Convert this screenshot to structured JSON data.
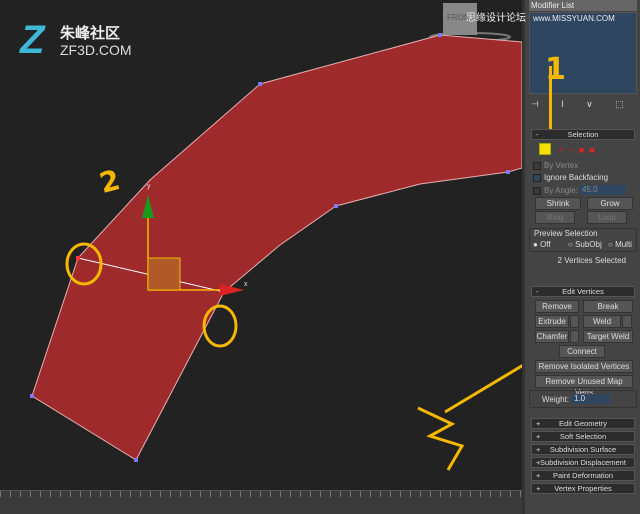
{
  "watermark": {
    "logo_cn": "朱峰社区",
    "logo_en": "ZF3D.COM",
    "site_cn": "思缘设计论坛",
    "site_url": "www.MISSYUAN.COM"
  },
  "viewport": {
    "label": "FRONT",
    "axis_x": "x",
    "axis_y": "y"
  },
  "annotations": {
    "one": "1",
    "two": "2"
  },
  "panel": {
    "modifier_list": "Modifier List",
    "selection": {
      "title": "Selection",
      "by_vertex": "By Vertex",
      "ignore_backfacing": "Ignore Backfacing",
      "by_angle": "By Angle:",
      "angle_value": "45.0",
      "shrink": "Shrink",
      "grow": "Grow",
      "ring": "Ring",
      "loop": "Loop",
      "preview_title": "Preview Selection",
      "off": "Off",
      "subobj": "SubObj",
      "multi": "Multi",
      "status": "2 Vertices Selected"
    },
    "edit_vertices": {
      "title": "Edit Vertices",
      "remove": "Remove",
      "break": "Break",
      "extrude": "Extrude",
      "weld": "Weld",
      "chamfer": "Chamfer",
      "target_weld": "Target Weld",
      "connect": "Connect",
      "remove_isolated": "Remove Isolated Vertices",
      "remove_unused": "Remove Unused Map Verts",
      "weight_label": "Weight:",
      "weight_value": "1.0"
    },
    "rollouts": [
      "Edit Geometry",
      "Soft Selection",
      "Subdivision Surface",
      "Subdivision Displacement",
      "Paint Deformation",
      "Vertex Properties"
    ]
  },
  "colors": {
    "poly": "#9e2a2b",
    "accent": "#f5b800"
  }
}
